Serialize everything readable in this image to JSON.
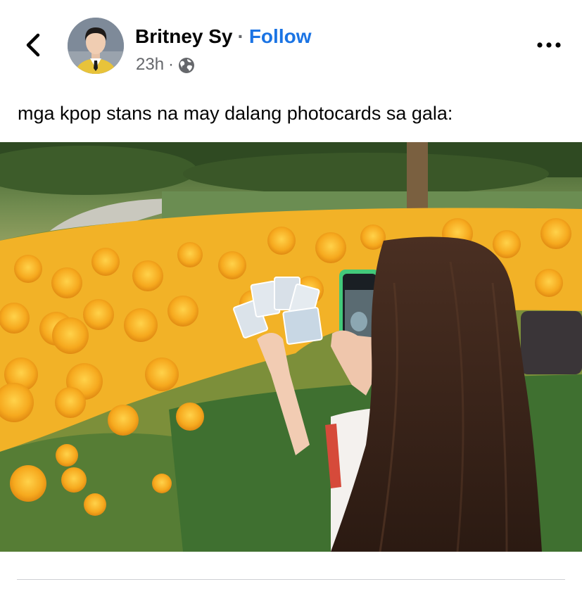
{
  "post": {
    "author_name": "Britney Sy",
    "separator": "·",
    "follow_label": "Follow",
    "timestamp": "23h",
    "meta_separator": "·",
    "audience_icon": "globe-icon",
    "caption": "mga kpop stans na may dalang photocards sa gala:"
  },
  "icons": {
    "back": "chevron-left-icon",
    "more": "more-horizontal-icon"
  },
  "colors": {
    "link": "#1b74e4",
    "secondary_text": "#65676b",
    "primary_text": "#050505",
    "divider": "#ced0d4"
  }
}
